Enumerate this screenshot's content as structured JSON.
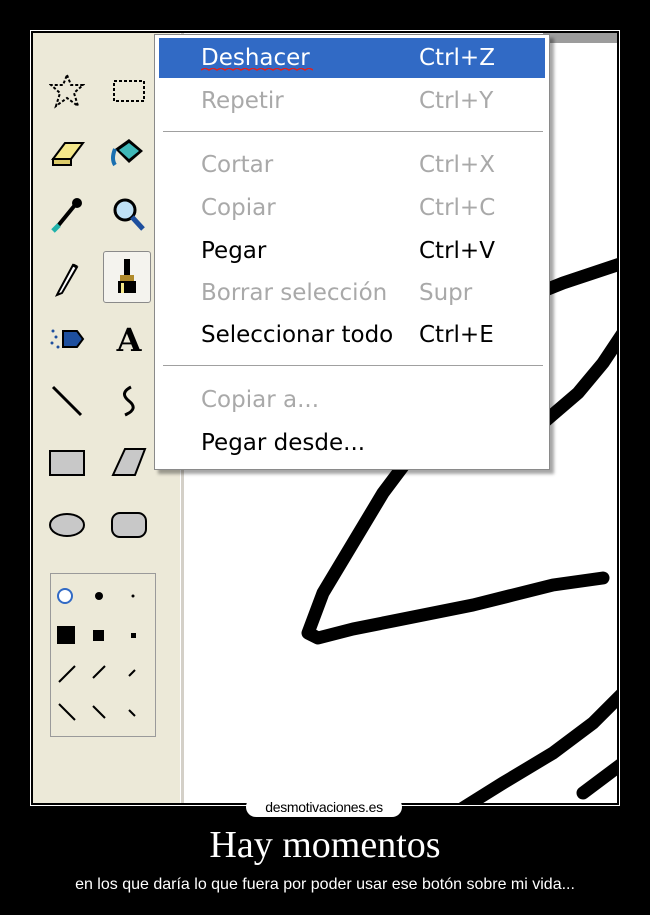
{
  "edit_menu": {
    "items": [
      {
        "label": "Deshacer",
        "shortcut": "Ctrl+Z",
        "state": "highlighted"
      },
      {
        "label": "Repetir",
        "shortcut": "Ctrl+Y",
        "state": "disabled"
      },
      {
        "label": "Cortar",
        "shortcut": "Ctrl+X",
        "state": "disabled"
      },
      {
        "label": "Copiar",
        "shortcut": "Ctrl+C",
        "state": "disabled"
      },
      {
        "label": "Pegar",
        "shortcut": "Ctrl+V",
        "state": "enabled"
      },
      {
        "label": "Borrar selección",
        "shortcut": "Supr",
        "state": "disabled"
      },
      {
        "label": "Seleccionar todo",
        "shortcut": "Ctrl+E",
        "state": "enabled"
      },
      {
        "label": "Copiar a...",
        "shortcut": "",
        "state": "disabled"
      },
      {
        "label": "Pegar desde...",
        "shortcut": "",
        "state": "enabled"
      }
    ]
  },
  "toolbox": {
    "tools": [
      "free-select-icon",
      "rect-select-icon",
      "eraser-icon",
      "fill-icon",
      "eyedropper-icon",
      "magnifier-icon",
      "pencil-icon",
      "brush-icon",
      "airbrush-icon",
      "text-icon",
      "line-icon",
      "curve-icon",
      "rectangle-icon",
      "polygon-icon",
      "ellipse-icon",
      "rounded-rect-icon"
    ],
    "active_tool": "brush-icon"
  },
  "colors": {
    "highlight": "#316AC5",
    "disabled": "#A9A9A9",
    "toolbox": "#ECE9D8"
  },
  "watermark": "desmotivaciones.es",
  "caption": {
    "title": "Hay momentos",
    "subtitle": "en los que daría lo que fuera por poder usar ese botón sobre mi vida..."
  }
}
